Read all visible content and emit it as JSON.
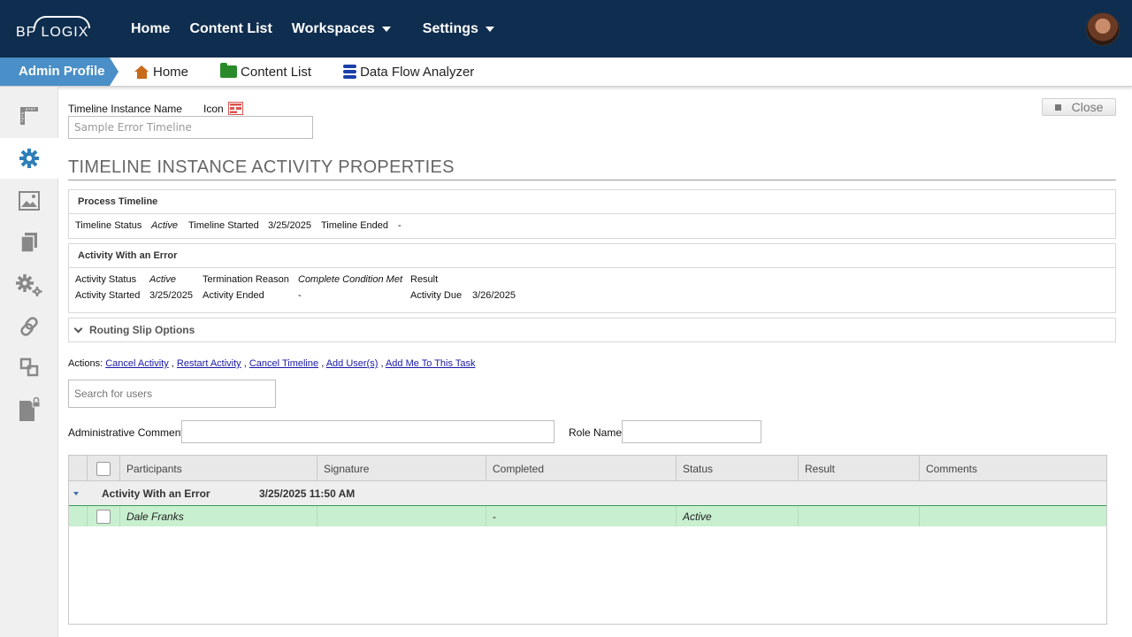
{
  "topbar": {
    "logo_text": "BP LOGIX",
    "nav": [
      {
        "label": "Home"
      },
      {
        "label": "Content List"
      },
      {
        "label": "Workspaces"
      },
      {
        "label": "Settings"
      }
    ]
  },
  "secbar": {
    "profile": "Admin Profile",
    "nav": [
      {
        "label": "Home",
        "icon": "home-icon"
      },
      {
        "label": "Content List",
        "icon": "folder-icon"
      },
      {
        "label": "Data Flow Analyzer",
        "icon": "database-icon"
      }
    ]
  },
  "sidebar": {
    "items": [
      "ruler-icon",
      "gear-icon",
      "image-icon",
      "documents-icon",
      "gears-icon",
      "link-icon",
      "shapes-icon",
      "locked-file-icon"
    ],
    "active_index": 1
  },
  "form": {
    "instance_name_label": "Timeline Instance Name",
    "icon_label": "Icon",
    "instance_name_value": "Sample Error Timeline",
    "close_label": "Close"
  },
  "title": "TIMELINE INSTANCE ACTIVITY PROPERTIES",
  "process_timeline": {
    "heading": "Process Timeline",
    "status_label": "Timeline Status",
    "status_value": "Active",
    "started_label": "Timeline Started",
    "started_value": "3/25/2025",
    "ended_label": "Timeline Ended",
    "ended_value": "-"
  },
  "activity": {
    "heading": "Activity With an Error",
    "status_label": "Activity Status",
    "status_value": "Active",
    "termination_label": "Termination Reason",
    "termination_value": "Complete Condition Met",
    "result_label": "Result",
    "started_label": "Activity Started",
    "started_value": "3/25/2025",
    "ended_label": "Activity Ended",
    "ended_value": "-",
    "due_label": "Activity Due",
    "due_value": "3/26/2025"
  },
  "routing": {
    "label": "Routing Slip Options"
  },
  "actions": {
    "label": "Actions:",
    "links": [
      "Cancel Activity",
      "Restart Activity",
      "Cancel Timeline",
      "Add User(s)",
      "Add Me To This Task"
    ],
    "sep": ","
  },
  "search": {
    "placeholder": "Search for users"
  },
  "comments": {
    "label": "Administrative Comments:",
    "value": ""
  },
  "role": {
    "label": "Role Name:",
    "value": ""
  },
  "grid": {
    "columns": [
      "Participants",
      "Signature",
      "Completed",
      "Status",
      "Result",
      "Comments"
    ],
    "group": {
      "name": "Activity With an Error",
      "date": "3/25/2025 11:50 AM"
    },
    "rows": [
      {
        "participant": "Dale Franks",
        "signature": "",
        "completed": "-",
        "status": "Active",
        "result": "",
        "comments": ""
      }
    ]
  }
}
